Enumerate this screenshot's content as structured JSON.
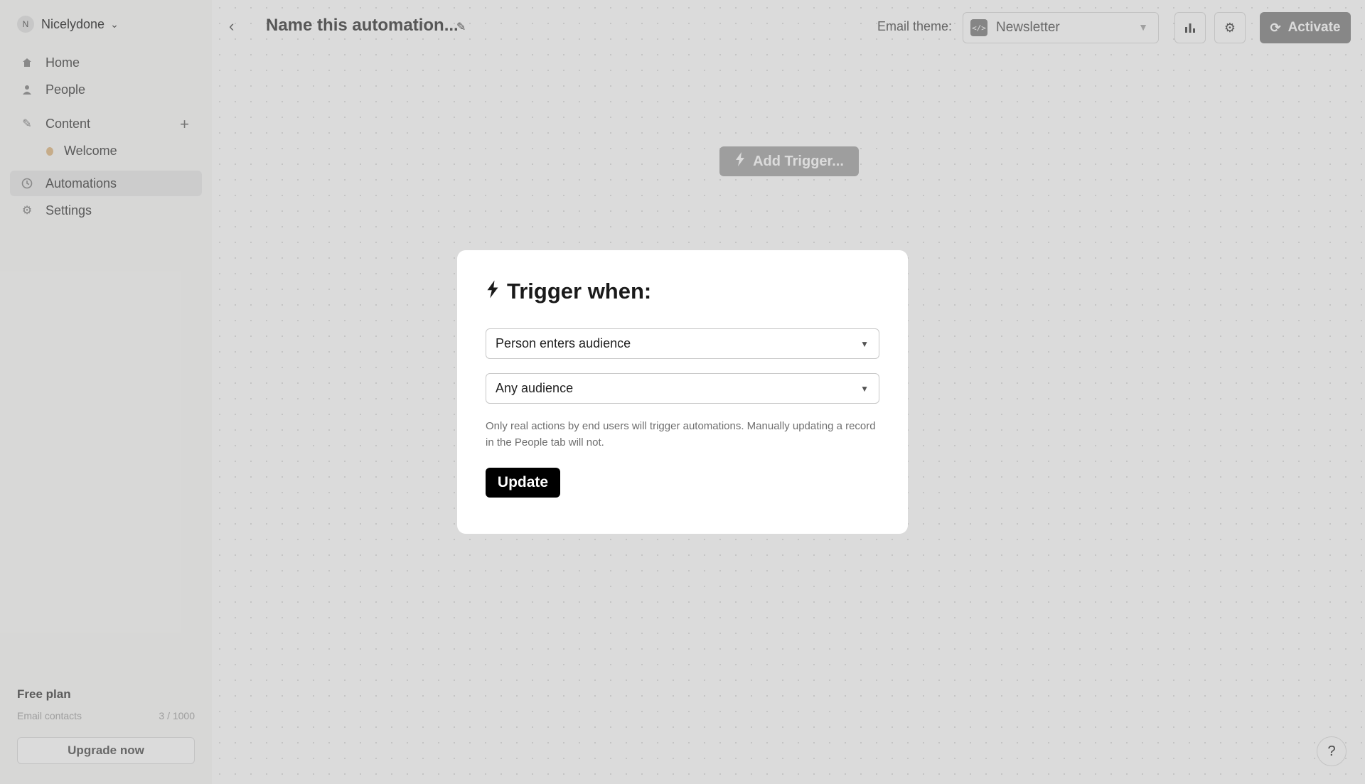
{
  "sidebar": {
    "workspace": {
      "initial": "N",
      "name": "Nicelydone"
    },
    "items": [
      {
        "label": "Home",
        "icon": "home-icon"
      },
      {
        "label": "People",
        "icon": "person-icon"
      },
      {
        "label": "Content",
        "icon": "pencil-icon"
      },
      {
        "label": "Welcome",
        "icon": "wave-icon"
      },
      {
        "label": "Automations",
        "icon": "clock-icon"
      },
      {
        "label": "Settings",
        "icon": "gear-icon"
      }
    ],
    "plan": {
      "title": "Free plan",
      "contacts_label": "Email contacts",
      "contacts_value": "3 / 1000",
      "upgrade_label": "Upgrade now"
    }
  },
  "topbar": {
    "title": "Name this automation...",
    "email_theme_label": "Email theme:",
    "email_theme_value": "Newsletter",
    "activate_label": "Activate"
  },
  "canvas": {
    "add_trigger_label": "Add Trigger..."
  },
  "modal": {
    "title": "Trigger when:",
    "trigger_select_value": "Person enters audience",
    "audience_select_value": "Any audience",
    "note": "Only real actions by end users will trigger automations. Manually updating a record in the People tab will not.",
    "update_label": "Update"
  },
  "help_label": "?",
  "colors": {
    "primary_button": "#000000",
    "activate_button": "#9e9e9e",
    "overlay": "rgba(0,0,0,0.14)"
  }
}
